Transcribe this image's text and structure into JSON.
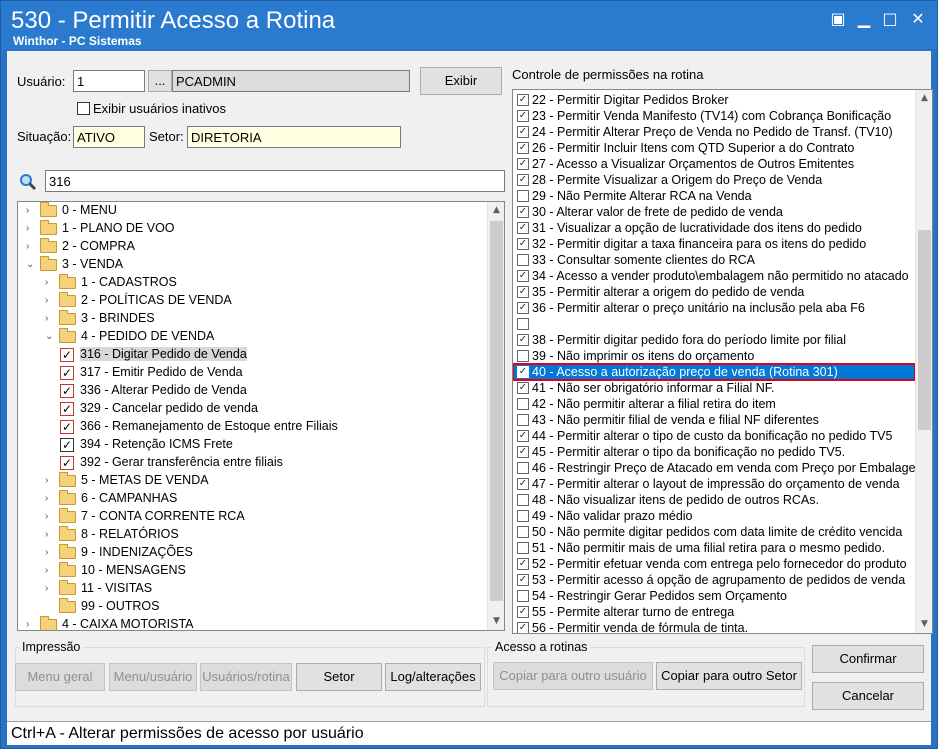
{
  "window": {
    "title": "530 - Permitir Acesso a Rotina",
    "subtitle": "Winthor - PC Sistemas",
    "controls": [
      "▣",
      "▁",
      "□",
      "✕"
    ]
  },
  "user": {
    "label": "Usuário:",
    "code": "1",
    "lookup_btn": "...",
    "name": "PCADMIN",
    "show_btn": "Exibir",
    "inactive_label": "Exibir usuários inativos"
  },
  "situacao": {
    "label": "Situação:",
    "value": "ATIVO"
  },
  "setor": {
    "label": "Setor:",
    "value": "DIRETORIA"
  },
  "search": {
    "value": "316",
    "icon": "search-icon"
  },
  "tree": [
    {
      "label": "0 - MENU",
      "level": 0,
      "arrow": "›",
      "folder": true
    },
    {
      "label": "1 - PLANO DE VOO",
      "level": 0,
      "arrow": "›",
      "folder": true
    },
    {
      "label": "2 - COMPRA",
      "level": 0,
      "arrow": "›",
      "folder": true
    },
    {
      "label": "3 - VENDA",
      "level": 0,
      "arrow": "⌄",
      "folder": true
    },
    {
      "label": "1 - CADASTROS",
      "level": 1,
      "arrow": "›",
      "folder": true
    },
    {
      "label": "2 - POLÍTICAS DE VENDA",
      "level": 1,
      "arrow": "›",
      "folder": true
    },
    {
      "label": "3 - BRINDES",
      "level": 1,
      "arrow": "›",
      "folder": true
    },
    {
      "label": "4 - PEDIDO DE VENDA",
      "level": 1,
      "arrow": "⌄",
      "folder": true
    },
    {
      "label": "316 - Digitar Pedido de Venda",
      "level": 2,
      "check": true,
      "red": true,
      "selected": true
    },
    {
      "label": "317 - Emitir Pedido de Venda",
      "level": 2,
      "check": true,
      "red": true
    },
    {
      "label": "336 - Alterar Pedido de Venda",
      "level": 2,
      "check": true,
      "red": true
    },
    {
      "label": "329 - Cancelar pedido de venda",
      "level": 2,
      "check": true,
      "red": true
    },
    {
      "label": "366 - Remanejamento de Estoque entre Filiais",
      "level": 2,
      "check": true,
      "red": true
    },
    {
      "label": "394 - Retenção ICMS Frete",
      "level": 2,
      "check": true,
      "red": false
    },
    {
      "label": "392 - Gerar transferência entre filiais",
      "level": 2,
      "check": true,
      "red": true
    },
    {
      "label": "5 - METAS DE VENDA",
      "level": 1,
      "arrow": "›",
      "folder": true
    },
    {
      "label": "6 - CAMPANHAS",
      "level": 1,
      "arrow": "›",
      "folder": true
    },
    {
      "label": "7 - CONTA CORRENTE RCA",
      "level": 1,
      "arrow": "›",
      "folder": true
    },
    {
      "label": "8 - RELATÓRIOS",
      "level": 1,
      "arrow": "›",
      "folder": true
    },
    {
      "label": "9 - INDENIZAÇÕES",
      "level": 1,
      "arrow": "›",
      "folder": true
    },
    {
      "label": "10 - MENSAGENS",
      "level": 1,
      "arrow": "›",
      "folder": true
    },
    {
      "label": "11 - VISITAS",
      "level": 1,
      "arrow": "›",
      "folder": true
    },
    {
      "label": "99 - OUTROS",
      "level": 1,
      "arrow": "",
      "folder": true
    },
    {
      "label": "4 - CAIXA MOTORISTA",
      "level": 0,
      "arrow": "›",
      "folder": true
    }
  ],
  "permissions": {
    "title": "Controle de permissões na rotina",
    "items": [
      {
        "label": "22 - Permitir Digitar Pedidos Broker",
        "checked": true
      },
      {
        "label": "23 - Permitir Venda Manifesto (TV14) com Cobrança Bonificação",
        "checked": true
      },
      {
        "label": "24 - Permitir Alterar Preço de Venda no Pedido de Transf. (TV10)",
        "checked": true
      },
      {
        "label": "26 - Permitir Incluir Itens com QTD Superior a do Contrato",
        "checked": true
      },
      {
        "label": "27 - Acesso a Visualizar Orçamentos de Outros Emitentes",
        "checked": true
      },
      {
        "label": "28 - Permite Visualizar a Origem do Preço de Venda",
        "checked": true
      },
      {
        "label": "29 - Não Permite Alterar RCA na Venda",
        "checked": false
      },
      {
        "label": "30 - Alterar valor de frete de pedido de venda",
        "checked": true
      },
      {
        "label": "31 - Visualizar a opção de lucratividade dos itens do pedido",
        "checked": true
      },
      {
        "label": "32 - Permitir digitar a taxa financeira para os itens do pedido",
        "checked": true
      },
      {
        "label": "33 - Consultar somente clientes do RCA",
        "checked": false
      },
      {
        "label": "34 - Acesso a vender produto\\embalagem não permitido no atacado",
        "checked": true
      },
      {
        "label": "35 - Permitir alterar a origem do pedido de venda",
        "checked": true
      },
      {
        "label": "36 - Permitir alterar o preço unitário na inclusão pela aba F6",
        "checked": true
      },
      {
        "label": "",
        "checked": false
      },
      {
        "label": "38 - Permitir digitar pedido fora do período limite por filial",
        "checked": true
      },
      {
        "label": "39 - Não imprimir os itens do orçamento",
        "checked": false
      },
      {
        "label": "40 - Acesso a autorização preço de venda (Rotina 301)",
        "checked": true,
        "selected": true
      },
      {
        "label": "41 - Não ser obrigatório informar a Filial NF.",
        "checked": true
      },
      {
        "label": "42 - Não permitir alterar a filial retira do item",
        "checked": false
      },
      {
        "label": "43 - Não permitir filial de venda e filial NF diferentes",
        "checked": false
      },
      {
        "label": "44 - Permitir alterar o tipo de custo da bonificação no pedido TV5",
        "checked": true
      },
      {
        "label": "45 - Permitir alterar o tipo da bonificação no pedido TV5.",
        "checked": true
      },
      {
        "label": "46 - Restringir Preço de Atacado em venda com Preço por Embalagem",
        "checked": false
      },
      {
        "label": "47 - Permitir alterar o layout de impressão do orçamento de venda",
        "checked": true
      },
      {
        "label": "48 - Não visualizar itens de pedido de outros RCAs.",
        "checked": false
      },
      {
        "label": "49 - Não validar prazo médio",
        "checked": false
      },
      {
        "label": "50 - Não permite digitar pedidos com data limite de crédito vencida",
        "checked": false
      },
      {
        "label": "51 - Não permitir mais de uma filial retira para o mesmo pedido.",
        "checked": false
      },
      {
        "label": "52 - Permitir efetuar venda com entrega pelo fornecedor do produto",
        "checked": true
      },
      {
        "label": "53 - Permitir acesso á opção de agrupamento de pedidos de venda",
        "checked": true
      },
      {
        "label": "54 - Restringir Gerar Pedidos sem Orçamento",
        "checked": false
      },
      {
        "label": "55 - Permite alterar turno de entrega",
        "checked": true
      },
      {
        "label": "56 - Permitir venda de fórmula de tinta.",
        "checked": true
      }
    ]
  },
  "impressao": {
    "title": "Impressão",
    "buttons": [
      "Menu geral",
      "Menu/usuário",
      "Usuários/rotina",
      "Setor",
      "Log/alterações"
    ]
  },
  "acesso": {
    "title": "Acesso a rotinas",
    "buttons": [
      "Copiar para outro usuário",
      "Copiar para outro Setor"
    ]
  },
  "actions": {
    "confirm": "Confirmar",
    "cancel": "Cancelar"
  },
  "status": "Ctrl+A - Alterar permissões de acesso por usuário"
}
